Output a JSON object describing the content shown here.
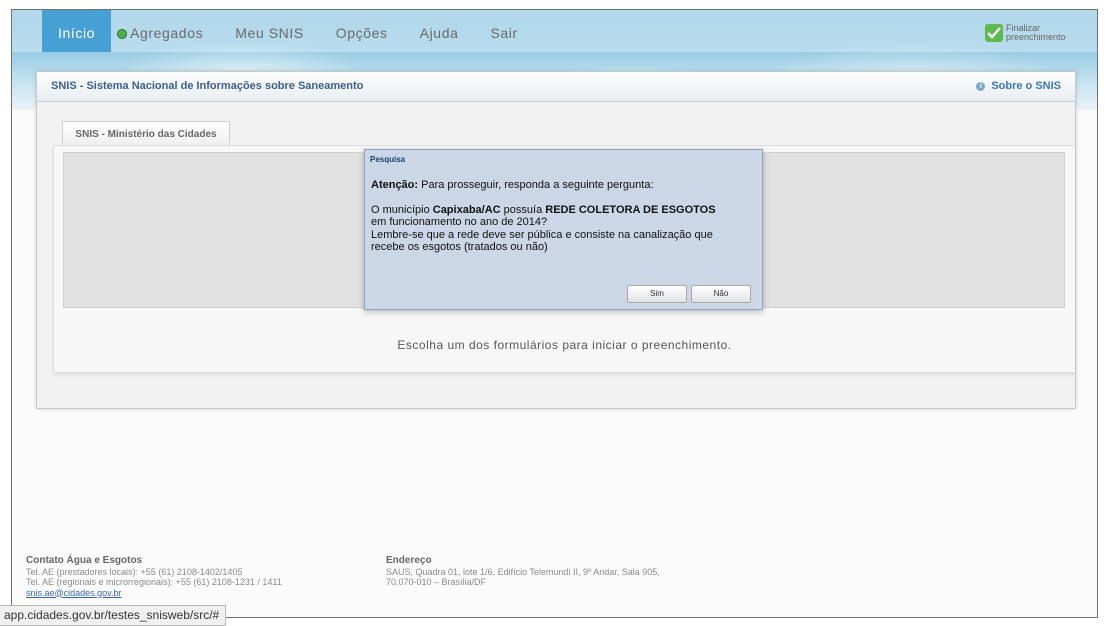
{
  "nav": {
    "items": [
      {
        "label": "Início"
      },
      {
        "label": "Agregados"
      },
      {
        "label": "Meu SNIS"
      },
      {
        "label": "Opções"
      },
      {
        "label": "Ajuda"
      },
      {
        "label": "Sair"
      }
    ],
    "finalizar": {
      "line1": "Finalizar",
      "line2": "preenchimento"
    }
  },
  "panel": {
    "title": "SNIS - Sistema Nacional de Informações sobre Saneamento",
    "sobre": "Sobre o SNIS",
    "tab": "SNIS - Ministério das Cidades",
    "choose_text": "Escolha um dos formulários para iniciar o preenchimento."
  },
  "dialog": {
    "title": "Pesquisa",
    "attention_label": "Atenção:",
    "attention_text": " Para prosseguir, responda a seguinte pergunta:",
    "q_prefix": "O município ",
    "q_municipio": "Capixaba/AC",
    "q_mid": " possuía ",
    "q_rede": "REDE COLETORA DE ESGOTOS",
    "q_line2": "em funcionamento no ano de 2014?",
    "q_line3": "Lembre-se que a rede deve ser pública e consiste na canalização que",
    "q_line4": "recebe os esgotos (tratados ou não)",
    "btn_sim": "Sim",
    "btn_nao": "Não"
  },
  "footer": {
    "contato": {
      "title": "Contato Água e Esgotos",
      "line1": "Tel. AE (prestadores locais): +55 (61) 2108-1402/1405",
      "line2": "Tel. AE (regionais e microrregionais): +55 (61) 2108-1231 / 1411",
      "email": "snis.ae@cidades.gov.br"
    },
    "endereco": {
      "title": "Endereço",
      "line1": "SAUS, Quadra 01, lote 1/6, Edifício Telemundi II, 9º Andar, Sala 905,",
      "line2": "70.070-010 – Brasília/DF"
    }
  },
  "statusbar": {
    "url": "app.cidades.gov.br/testes_snisweb/src/#"
  },
  "colors": {
    "accent": "#47a0d4",
    "dialog_bg": "#cbd7e6",
    "title_blue": "#3a5f8e"
  }
}
